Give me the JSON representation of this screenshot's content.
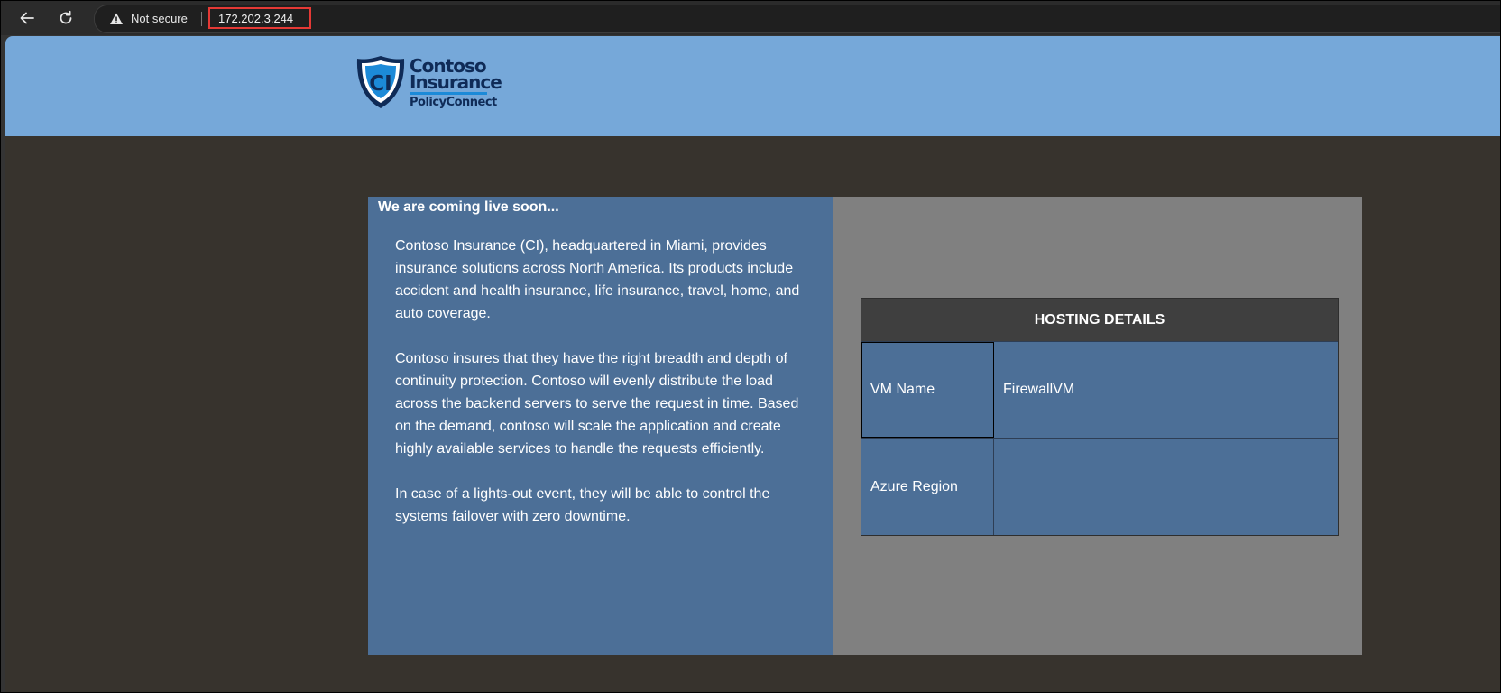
{
  "browser": {
    "security_label": "Not secure",
    "url": "172.202.3.244",
    "icons": {
      "back": "arrow-left-icon",
      "reload": "reload-icon",
      "security": "warning-triangle-icon"
    }
  },
  "header": {
    "logo": {
      "initials": "CI",
      "line1": "Contoso",
      "line2": "Insurance",
      "line3": "PolicyConnect"
    }
  },
  "main": {
    "heading": "We are coming live soon...",
    "paragraphs": [
      "Contoso Insurance (CI), headquartered in Miami, provides insurance solutions across North America. Its products include accident and health insurance, life insurance, travel, home, and auto coverage.",
      "Contoso insures that they have the right breadth and depth of continuity protection. Contoso will evenly distribute the load across the backend servers to serve the request in time. Based on the demand, contoso will scale the application and create highly available services to handle the requests efficiently.",
      "In case of a lights-out event, they will be able to control the systems failover with zero downtime."
    ]
  },
  "hosting": {
    "title": "HOSTING DETAILS",
    "rows": [
      {
        "label": "VM Name",
        "value": "FirewallVM"
      },
      {
        "label": "Azure Region",
        "value": ""
      }
    ]
  },
  "colors": {
    "header_bg": "#76a8d9",
    "page_bg": "#37332d",
    "panel_blue": "#4c6f97",
    "panel_gray": "#808080",
    "table_head": "#3f3f3f",
    "url_highlight": "#e53935",
    "logo_navy": "#0f2b57"
  }
}
